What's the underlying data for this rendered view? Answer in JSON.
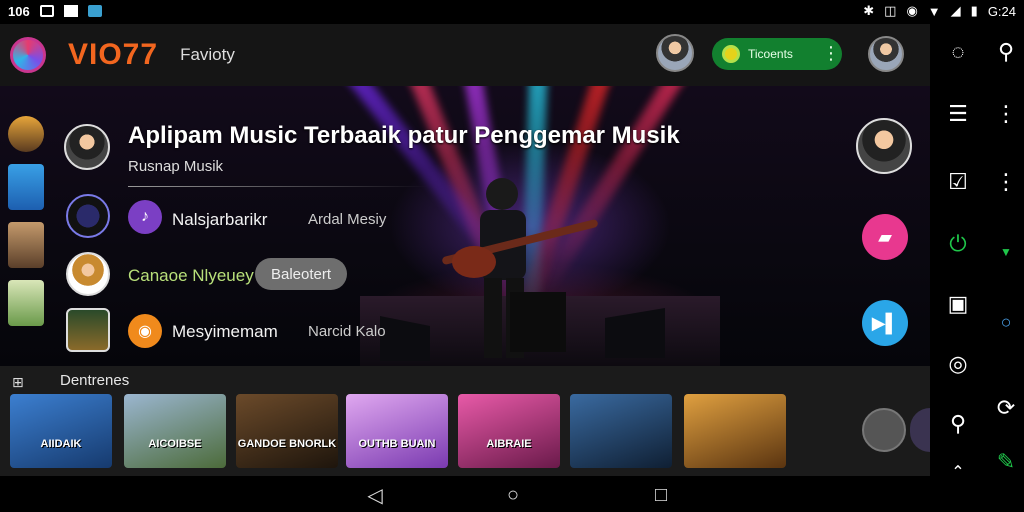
{
  "status": {
    "left_time": "106",
    "right_time": "G:24"
  },
  "header": {
    "brand": "VIO77",
    "subtitle": "Favioty",
    "pill_label": "Ticoents"
  },
  "hero": {
    "title": "Aplipam Music Terbaaik patur Penggemar Musik",
    "subtitle": "Rusnap Musik",
    "rows": [
      {
        "name": "Nalsjarbarikr",
        "sub": "Ardal Mesiy"
      },
      {
        "name": "Canaoe Nlyeuey",
        "chip": "Baleotert"
      },
      {
        "name": "Mesyimemam",
        "sub": "Narcid Kalo"
      }
    ]
  },
  "recommend": {
    "title": "Dentrenes",
    "albums": [
      {
        "label": "AIIDAIK",
        "bg": "#2b5f9e"
      },
      {
        "label": "AICOIBSE",
        "bg": "#4c6b3a"
      },
      {
        "label": "GANDOE BNORLK",
        "bg": "#3a2d20"
      },
      {
        "label": "OUTHB BUAIN",
        "bg": "#9a5bd1"
      },
      {
        "label": "AIBRAIE",
        "bg": "#b0327a"
      },
      {
        "label": "",
        "bg": "#1f3a5c"
      },
      {
        "label": "",
        "bg": "#7a4a14"
      }
    ]
  },
  "colors": {
    "accent_orange": "#f2661f",
    "pill_green": "#12802f",
    "fab_pink": "#e8388f",
    "fab_blue": "#2aa6e8",
    "purple": "#7b3fc4",
    "orange": "#f08a1c"
  },
  "icons": {
    "rail": [
      "chat-search-icon",
      "search-icon",
      "list-icon",
      "more-vert-icon",
      "checkbox-icon",
      "more-vert-icon",
      "power-icon",
      "chevron-down-icon",
      "chart-icon",
      "circle-icon",
      "music-icon",
      "search-icon",
      "sync-icon",
      "edit-icon",
      "chevron-up-icon"
    ],
    "nav": [
      "back-icon",
      "home-icon",
      "recents-icon"
    ]
  }
}
